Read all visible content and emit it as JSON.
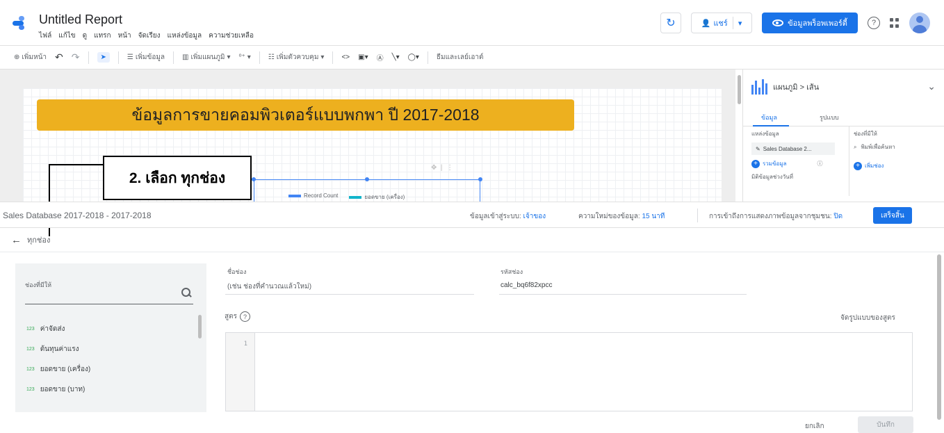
{
  "app": {
    "title": "Untitled Report",
    "menu": [
      "ไฟล์",
      "แก้ไข",
      "ดู",
      "แทรก",
      "หน้า",
      "จัดเรียง",
      "แหล่งข้อมูล",
      "ความช่วยเหลือ"
    ],
    "share_label": "แชร์",
    "view_button_label": "ข้อมูลพร็อพเพอร์ตี้",
    "help_glyph": "?"
  },
  "toolbar": {
    "add_page": "เพิ่มหน้า",
    "add_data": "เพิ่มข้อมูล",
    "add_chart": "เพิ่มแผนภูมิ",
    "add_control": "เพิ่มตัวควบคุม",
    "theme_layout": "ธีมและเลย์เอาต์"
  },
  "canvas": {
    "banner_text": "ข้อมูลการขายคอมพิวเตอร์แบบพกพา ปี 2017-2018",
    "legend_ghost": [
      "Record Count",
      "ยอดขาย (เครื่อง)"
    ],
    "annotation": "2. เลือก ทุกช่อง"
  },
  "properties_panel": {
    "chart_type": "แผนภูมิ > เส้น",
    "tab_data": "ข้อมูล",
    "tab_style": "รูปแบบ",
    "data_source_label": "แหล่งข้อมูล",
    "data_source_value": "Sales Database 2...",
    "add_data_label": "รวมข้อมูล",
    "blend_label": "มิติข้อมูลช่วงวันที่",
    "available_fields_label": "ช่องที่มีให้",
    "search_placeholder": "พิมพ์เพื่อค้นหา",
    "add_field_label": "เพิ่มช่อง"
  },
  "datasource_bar": {
    "name": "Sales Database 2017-2018 - 2017-2018",
    "credentials_label": "ข้อมูลเข้าสู่ระบบ:",
    "credentials_value": "เจ้าของ",
    "freshness_label": "ความใหม่ของข้อมูล:",
    "freshness_value": "15 นาที",
    "community_label": "การเข้าถึงการแสดงภาพข้อมูลจากชุมชน:",
    "community_value": "ปิด",
    "done_button": "เสร็จสิ้น"
  },
  "breadcrumb": {
    "label": "ทุกช่อง"
  },
  "fields_panel": {
    "header": "ช่องที่มีให้",
    "items": [
      {
        "type": "123",
        "name": "ค่าจัดส่ง"
      },
      {
        "type": "123",
        "name": "ต้นทุนค่าแรง"
      },
      {
        "type": "123",
        "name": "ยอดขาย (เครื่อง)"
      },
      {
        "type": "123",
        "name": "ยอดขาย (บาท)"
      }
    ]
  },
  "form": {
    "field_name_label": "ชื่อช่อง",
    "field_name_placeholder": "(เช่น ช่องที่คำนวณแล้วใหม่)",
    "field_id_label": "รหัสช่อง",
    "field_id_value": "calc_bq6f82xpcc",
    "formula_label": "สูตร",
    "format_formula_label": "จัดรูปแบบของสูตร",
    "line_number": "1",
    "cancel_label": "ยกเลิก",
    "save_label": "บันทึก"
  },
  "colors": {
    "accent": "#1a73e8",
    "banner": "#edb01f",
    "field_type": "#34a853"
  }
}
